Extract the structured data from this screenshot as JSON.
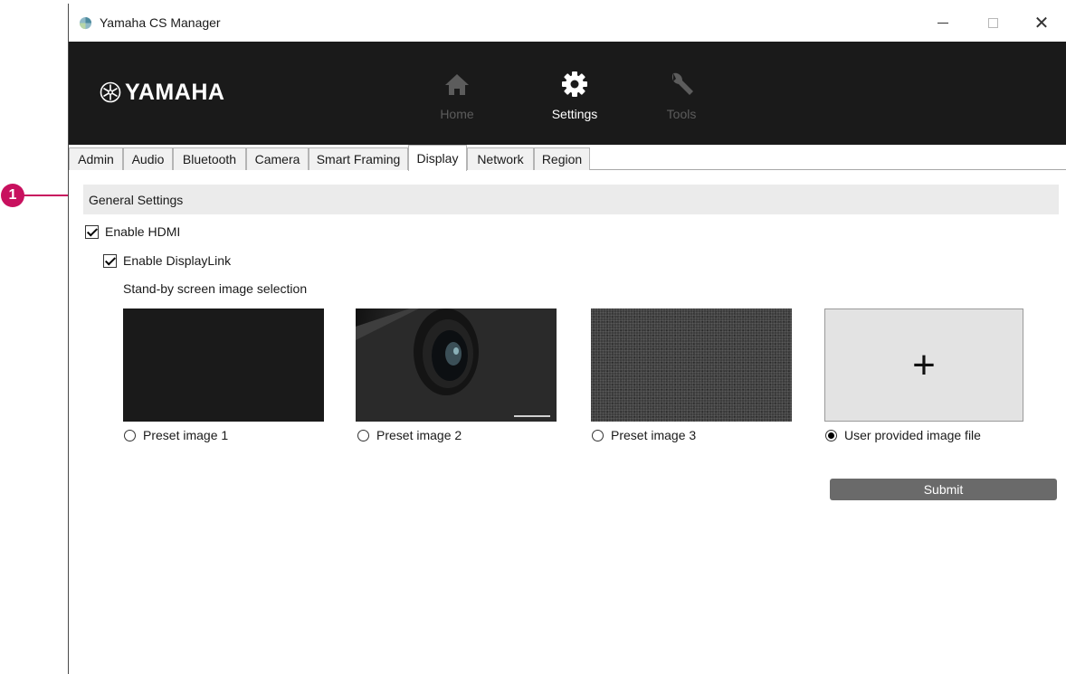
{
  "callout": {
    "number": "1"
  },
  "window": {
    "title": "Yamaha CS Manager"
  },
  "header": {
    "logo_text": "YAMAHA",
    "nav": [
      {
        "label": "Home",
        "icon": "home-icon",
        "active": false
      },
      {
        "label": "Settings",
        "icon": "gear-icon",
        "active": true
      },
      {
        "label": "Tools",
        "icon": "wrench-icon",
        "active": false
      }
    ]
  },
  "tabs": [
    "Admin",
    "Audio",
    "Bluetooth",
    "Camera",
    "Smart Framing",
    "Display",
    "Network",
    "Region"
  ],
  "active_tab": "Display",
  "general_settings": {
    "title": "General Settings",
    "enable_hdmi": {
      "label": "Enable HDMI",
      "checked": true
    },
    "enable_displaylink": {
      "label": "Enable DisplayLink",
      "checked": true
    },
    "standby_label": "Stand-by screen image selection",
    "images": [
      {
        "label": "Preset image 1",
        "selected": false
      },
      {
        "label": "Preset image 2",
        "selected": false
      },
      {
        "label": "Preset image 3",
        "selected": false
      },
      {
        "label": "User provided image file",
        "selected": true
      }
    ],
    "upload_symbol": "+",
    "submit_label": "Submit"
  },
  "colors": {
    "header_bg": "#1a1a1a",
    "callout": "#c8105e",
    "submit_bg": "#6a6a6a",
    "section_bg": "#ebebeb"
  }
}
